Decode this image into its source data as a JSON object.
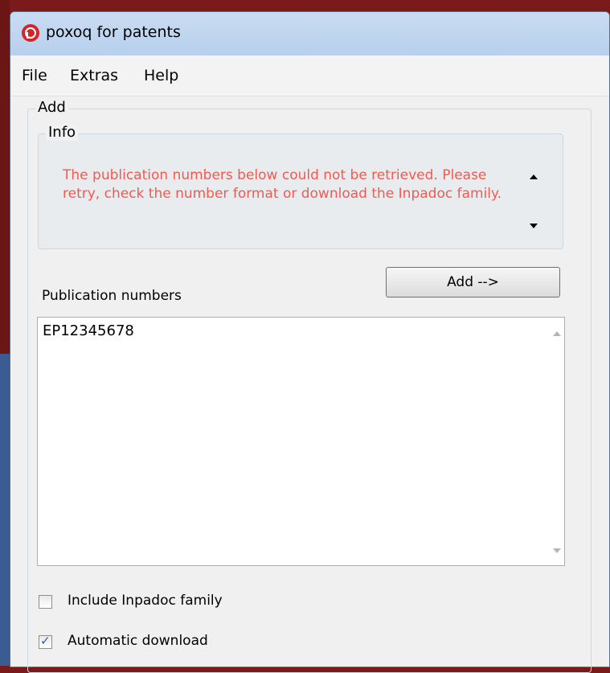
{
  "window": {
    "title": "poxoq for patents"
  },
  "menu": [
    "File",
    "Extras",
    "Help"
  ],
  "add_group": {
    "title": "Add",
    "info": {
      "title": "Info",
      "message": "The publication numbers below could not be retrieved. Please retry, check the number format or download the Inpadoc family.",
      "message_color": "#f05a50"
    },
    "publication_label": "Publication numbers",
    "add_button_label": "Add -->",
    "publication_numbers": "EP12345678",
    "options": [
      {
        "label": "Include Inpadoc family",
        "checked": false
      },
      {
        "label": "Automatic download",
        "checked": true
      }
    ]
  }
}
